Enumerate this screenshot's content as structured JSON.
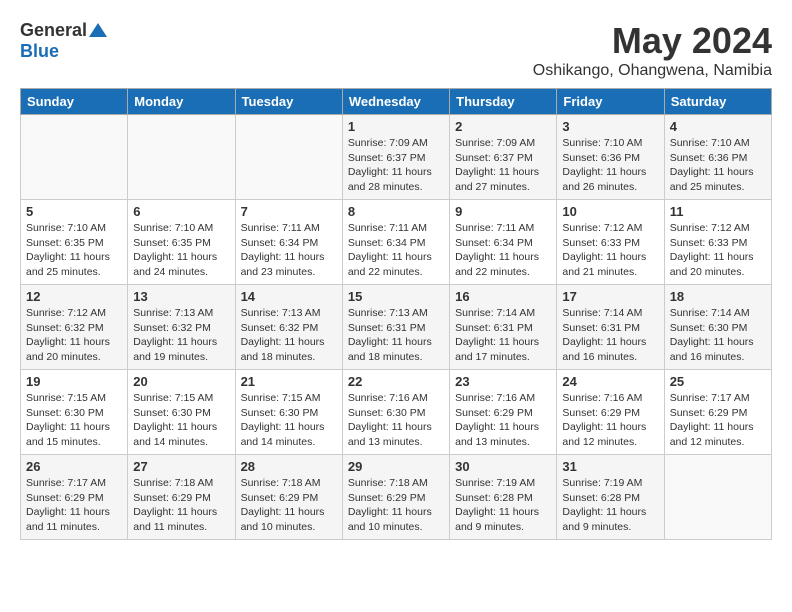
{
  "header": {
    "logo_general": "General",
    "logo_blue": "Blue",
    "month_year": "May 2024",
    "location": "Oshikango, Ohangwena, Namibia"
  },
  "weekdays": [
    "Sunday",
    "Monday",
    "Tuesday",
    "Wednesday",
    "Thursday",
    "Friday",
    "Saturday"
  ],
  "weeks": [
    [
      {
        "day": "",
        "info": ""
      },
      {
        "day": "",
        "info": ""
      },
      {
        "day": "",
        "info": ""
      },
      {
        "day": "1",
        "info": "Sunrise: 7:09 AM\nSunset: 6:37 PM\nDaylight: 11 hours\nand 28 minutes."
      },
      {
        "day": "2",
        "info": "Sunrise: 7:09 AM\nSunset: 6:37 PM\nDaylight: 11 hours\nand 27 minutes."
      },
      {
        "day": "3",
        "info": "Sunrise: 7:10 AM\nSunset: 6:36 PM\nDaylight: 11 hours\nand 26 minutes."
      },
      {
        "day": "4",
        "info": "Sunrise: 7:10 AM\nSunset: 6:36 PM\nDaylight: 11 hours\nand 25 minutes."
      }
    ],
    [
      {
        "day": "5",
        "info": "Sunrise: 7:10 AM\nSunset: 6:35 PM\nDaylight: 11 hours\nand 25 minutes."
      },
      {
        "day": "6",
        "info": "Sunrise: 7:10 AM\nSunset: 6:35 PM\nDaylight: 11 hours\nand 24 minutes."
      },
      {
        "day": "7",
        "info": "Sunrise: 7:11 AM\nSunset: 6:34 PM\nDaylight: 11 hours\nand 23 minutes."
      },
      {
        "day": "8",
        "info": "Sunrise: 7:11 AM\nSunset: 6:34 PM\nDaylight: 11 hours\nand 22 minutes."
      },
      {
        "day": "9",
        "info": "Sunrise: 7:11 AM\nSunset: 6:34 PM\nDaylight: 11 hours\nand 22 minutes."
      },
      {
        "day": "10",
        "info": "Sunrise: 7:12 AM\nSunset: 6:33 PM\nDaylight: 11 hours\nand 21 minutes."
      },
      {
        "day": "11",
        "info": "Sunrise: 7:12 AM\nSunset: 6:33 PM\nDaylight: 11 hours\nand 20 minutes."
      }
    ],
    [
      {
        "day": "12",
        "info": "Sunrise: 7:12 AM\nSunset: 6:32 PM\nDaylight: 11 hours\nand 20 minutes."
      },
      {
        "day": "13",
        "info": "Sunrise: 7:13 AM\nSunset: 6:32 PM\nDaylight: 11 hours\nand 19 minutes."
      },
      {
        "day": "14",
        "info": "Sunrise: 7:13 AM\nSunset: 6:32 PM\nDaylight: 11 hours\nand 18 minutes."
      },
      {
        "day": "15",
        "info": "Sunrise: 7:13 AM\nSunset: 6:31 PM\nDaylight: 11 hours\nand 18 minutes."
      },
      {
        "day": "16",
        "info": "Sunrise: 7:14 AM\nSunset: 6:31 PM\nDaylight: 11 hours\nand 17 minutes."
      },
      {
        "day": "17",
        "info": "Sunrise: 7:14 AM\nSunset: 6:31 PM\nDaylight: 11 hours\nand 16 minutes."
      },
      {
        "day": "18",
        "info": "Sunrise: 7:14 AM\nSunset: 6:30 PM\nDaylight: 11 hours\nand 16 minutes."
      }
    ],
    [
      {
        "day": "19",
        "info": "Sunrise: 7:15 AM\nSunset: 6:30 PM\nDaylight: 11 hours\nand 15 minutes."
      },
      {
        "day": "20",
        "info": "Sunrise: 7:15 AM\nSunset: 6:30 PM\nDaylight: 11 hours\nand 14 minutes."
      },
      {
        "day": "21",
        "info": "Sunrise: 7:15 AM\nSunset: 6:30 PM\nDaylight: 11 hours\nand 14 minutes."
      },
      {
        "day": "22",
        "info": "Sunrise: 7:16 AM\nSunset: 6:30 PM\nDaylight: 11 hours\nand 13 minutes."
      },
      {
        "day": "23",
        "info": "Sunrise: 7:16 AM\nSunset: 6:29 PM\nDaylight: 11 hours\nand 13 minutes."
      },
      {
        "day": "24",
        "info": "Sunrise: 7:16 AM\nSunset: 6:29 PM\nDaylight: 11 hours\nand 12 minutes."
      },
      {
        "day": "25",
        "info": "Sunrise: 7:17 AM\nSunset: 6:29 PM\nDaylight: 11 hours\nand 12 minutes."
      }
    ],
    [
      {
        "day": "26",
        "info": "Sunrise: 7:17 AM\nSunset: 6:29 PM\nDaylight: 11 hours\nand 11 minutes."
      },
      {
        "day": "27",
        "info": "Sunrise: 7:18 AM\nSunset: 6:29 PM\nDaylight: 11 hours\nand 11 minutes."
      },
      {
        "day": "28",
        "info": "Sunrise: 7:18 AM\nSunset: 6:29 PM\nDaylight: 11 hours\nand 10 minutes."
      },
      {
        "day": "29",
        "info": "Sunrise: 7:18 AM\nSunset: 6:29 PM\nDaylight: 11 hours\nand 10 minutes."
      },
      {
        "day": "30",
        "info": "Sunrise: 7:19 AM\nSunset: 6:28 PM\nDaylight: 11 hours\nand 9 minutes."
      },
      {
        "day": "31",
        "info": "Sunrise: 7:19 AM\nSunset: 6:28 PM\nDaylight: 11 hours\nand 9 minutes."
      },
      {
        "day": "",
        "info": ""
      }
    ]
  ]
}
